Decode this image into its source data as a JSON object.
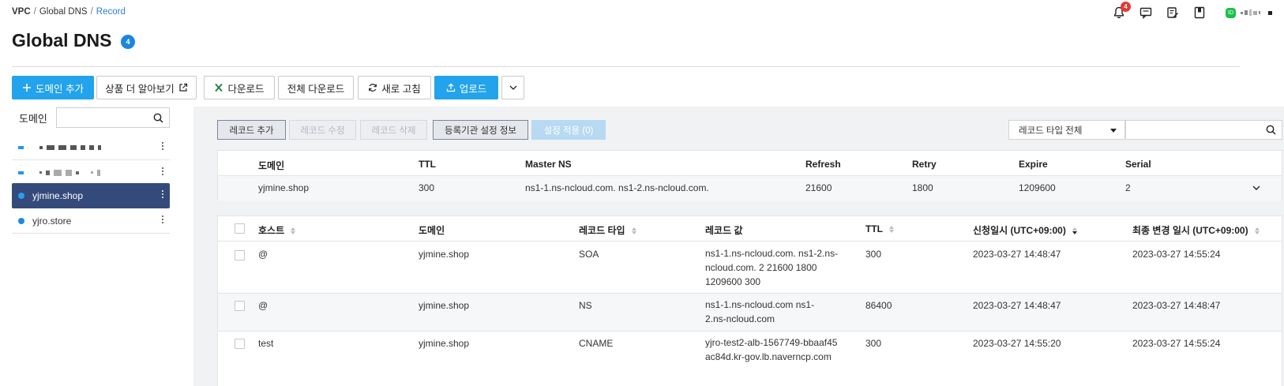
{
  "breadcrumb": {
    "root": "VPC",
    "sep": "/",
    "level2": "Global DNS",
    "current": "Record"
  },
  "header": {
    "notification_count": "4",
    "user_badge": "ID"
  },
  "page": {
    "title": "Global DNS",
    "badge": "4"
  },
  "toolbar": {
    "add_domain": "도메인 추가",
    "learn_more": "상품 더 알아보기",
    "download": "다운로드",
    "download_all": "전체 다운로드",
    "refresh": "새로 고침",
    "upload": "업로드"
  },
  "sidebar": {
    "label": "도메인",
    "search_placeholder": "",
    "items": [
      {
        "label": "",
        "masked": true
      },
      {
        "label": "",
        "masked": true
      },
      {
        "label": "yjmine.shop",
        "selected": true
      },
      {
        "label": "yjro.store"
      }
    ]
  },
  "record_actions": {
    "add": "레코드 추가",
    "edit": "레코드 수정",
    "delete": "레코드 삭제",
    "registrar": "등록기관 설정 정보",
    "apply": "설정 적용 (0)"
  },
  "filter": {
    "type_selected": "레코드 타입 전체",
    "search_placeholder": ""
  },
  "domain_info": {
    "headers": [
      "도메인",
      "TTL",
      "Master NS",
      "Refresh",
      "Retry",
      "Expire",
      "Serial"
    ],
    "row": [
      "yjmine.shop",
      "300",
      "ns1-1.ns-ncloud.com. ns1-2.ns-ncloud.com.",
      "21600",
      "1800",
      "1209600",
      "2"
    ]
  },
  "records": {
    "headers": [
      "호스트",
      "도메인",
      "레코드 타입",
      "레코드 값",
      "TTL",
      "신청일시 (UTC+09:00)",
      "최종 변경 일시 (UTC+09:00)"
    ],
    "rows": [
      [
        "@",
        "yjmine.shop",
        "SOA",
        "ns1-1.ns-ncloud.com. ns1-2.ns-ncloud.com. 2 21600 1800 1209600 300",
        "300",
        "2023-03-27 14:48:47",
        "2023-03-27 14:55:24"
      ],
      [
        "@",
        "yjmine.shop",
        "NS",
        "ns1-1.ns-ncloud.com ns1-2.ns-ncloud.com",
        "86400",
        "2023-03-27 14:48:47",
        "2023-03-27 14:48:47"
      ],
      [
        "test",
        "yjmine.shop",
        "CNAME",
        "yjro-test2-alb-1567749-bbaaf45ac84d.kr-gov.lb.naverncp.com",
        "300",
        "2023-03-27 14:55:20",
        "2023-03-27 14:55:24"
      ]
    ]
  },
  "colors": {
    "primary": "#22a3ec",
    "selected_row": "#344a7a",
    "badge": "#1a86e0",
    "notif": "#e53935"
  }
}
